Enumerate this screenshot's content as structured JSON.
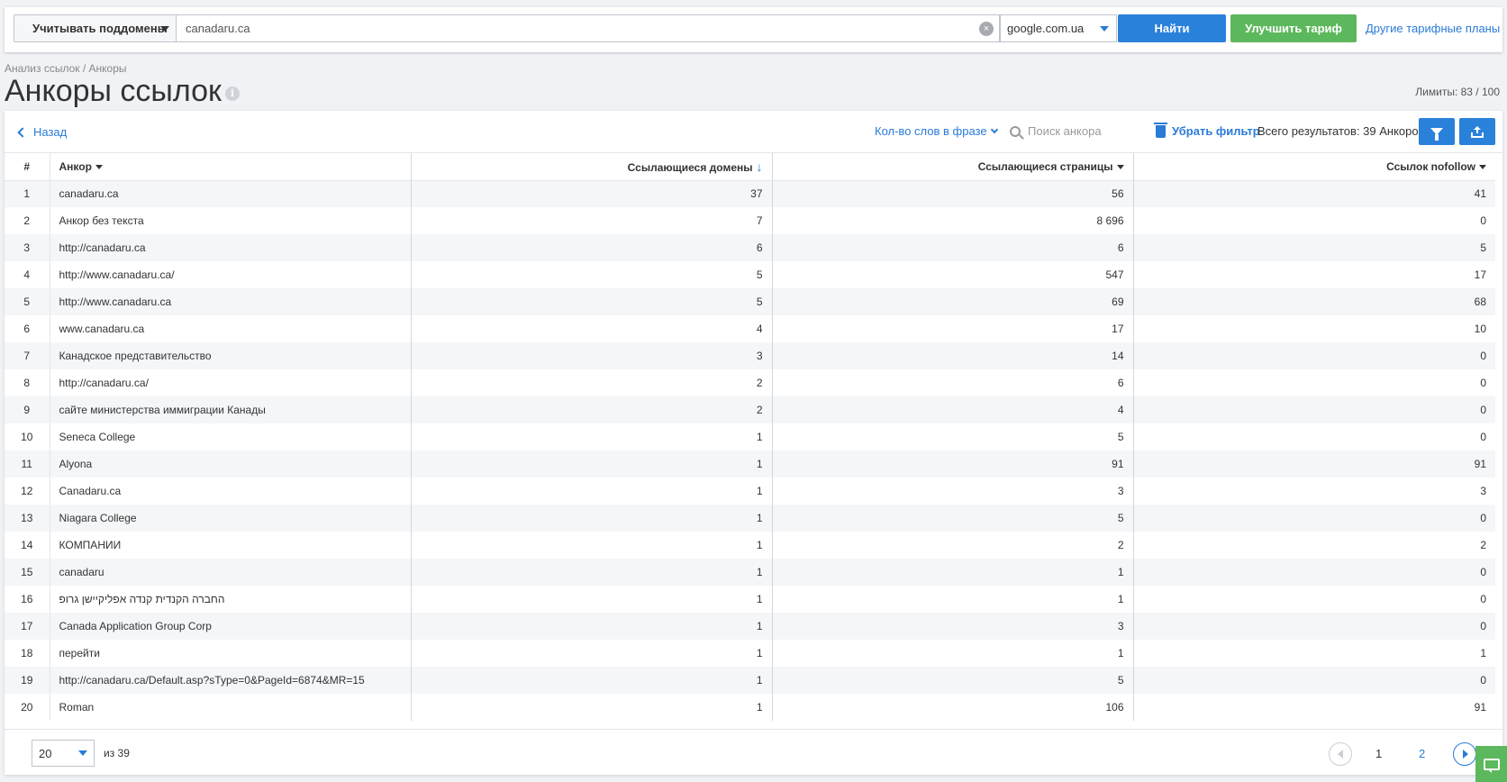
{
  "header": {
    "subdomains_label": "Учитывать поддомены",
    "domain_value": "canadaru.ca",
    "engine_value": "google.com.ua",
    "find_label": "Найти",
    "upgrade_label": "Улучшить тариф",
    "other_plans_label": "Другие тарифные планы"
  },
  "page": {
    "breadcrumb": "Анализ ссылок / Анкоры",
    "title": "Анкоры ссылок",
    "limits": "Лимиты: 83 / 100"
  },
  "toolbar": {
    "back_label": "Назад",
    "words_filter_label": "Кол-во слов в фразе",
    "search_placeholder": "Поиск анкора",
    "remove_filter_label": "Убрать фильтр",
    "total_label": "Всего результатов: 39 Анкоров"
  },
  "table": {
    "columns": [
      "#",
      "Анкор",
      "Ссылающиеся домены",
      "Ссылающиеся страницы",
      "Ссылок nofollow"
    ],
    "rows": [
      [
        "1",
        "canadaru.ca",
        "37",
        "56",
        "41"
      ],
      [
        "2",
        "Анкор без текста",
        "7",
        "8 696",
        "0"
      ],
      [
        "3",
        "http://canadaru.ca",
        "6",
        "6",
        "5"
      ],
      [
        "4",
        "http://www.canadaru.ca/",
        "5",
        "547",
        "17"
      ],
      [
        "5",
        "http://www.canadaru.ca",
        "5",
        "69",
        "68"
      ],
      [
        "6",
        "www.canadaru.ca",
        "4",
        "17",
        "10"
      ],
      [
        "7",
        "Канадское представительство",
        "3",
        "14",
        "0"
      ],
      [
        "8",
        "http://canadaru.ca/",
        "2",
        "6",
        "0"
      ],
      [
        "9",
        "сайте министерства иммиграции Канады",
        "2",
        "4",
        "0"
      ],
      [
        "10",
        "Seneca College",
        "1",
        "5",
        "0"
      ],
      [
        "11",
        "Alyona",
        "1",
        "91",
        "91"
      ],
      [
        "12",
        "Canadaru.ca",
        "1",
        "3",
        "3"
      ],
      [
        "13",
        "Niagara College",
        "1",
        "5",
        "0"
      ],
      [
        "14",
        "КОМПАНИИ",
        "1",
        "2",
        "2"
      ],
      [
        "15",
        "canadaru",
        "1",
        "1",
        "0"
      ],
      [
        "16",
        "החברה הקנדית קנדה אפליקיישן גרופ",
        "1",
        "1",
        "0"
      ],
      [
        "17",
        "Canada Application Group Corp",
        "1",
        "3",
        "0"
      ],
      [
        "18",
        "перейти",
        "1",
        "1",
        "1"
      ],
      [
        "19",
        "http://canadaru.ca/Default.asp?sType=0&PageId=6874&MR=15",
        "1",
        "5",
        "0"
      ],
      [
        "20",
        "Roman",
        "1",
        "106",
        "91"
      ]
    ]
  },
  "pagination": {
    "per_page": "20",
    "of_total": "из 39",
    "page_1": "1",
    "page_2": "2"
  },
  "icons": {
    "clear": "clear-icon",
    "info": "info-icon",
    "back": "chevron-left-icon",
    "search": "search-icon",
    "trash": "trash-icon",
    "filter": "filter-icon",
    "export": "export-icon",
    "chat": "chat-icon"
  },
  "colors": {
    "primary": "#2a81da",
    "success": "#5cb85c",
    "link": "#2a7bd7"
  }
}
